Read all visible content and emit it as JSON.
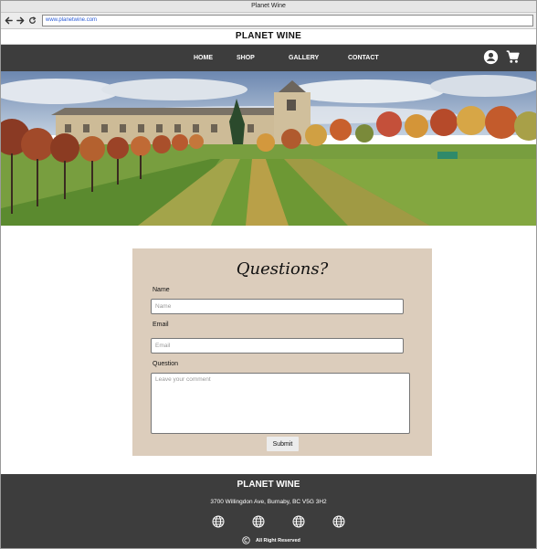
{
  "browser": {
    "window_title": "Planet Wine",
    "url": "www.planetwine.com"
  },
  "site": {
    "brand": "PLANET WINE"
  },
  "nav": {
    "items": [
      "HOME",
      "SHOP",
      "GALLERY",
      "CONTACT"
    ],
    "icons": [
      "account-icon",
      "cart-icon"
    ]
  },
  "hero": {
    "image": "vineyard-estate-photo"
  },
  "form": {
    "title": "Questions?",
    "name_label": "Name",
    "name_placeholder": "Name",
    "email_label": "Email",
    "email_placeholder": "Email",
    "question_label": "Question",
    "question_placeholder": "Leave your comment",
    "submit_label": "Submit"
  },
  "footer": {
    "brand": "PLANET WINE",
    "address": "3700 Willingdon Ave, Burnaby, BC V5G 3H2",
    "social_icons": [
      "globe-icon",
      "globe-icon",
      "globe-icon",
      "globe-icon"
    ],
    "copyright": "All Right Reserved"
  },
  "colors": {
    "nav_bg": "#3d3d3d",
    "form_bg": "#dccdbc",
    "link": "#2a5bd7"
  }
}
